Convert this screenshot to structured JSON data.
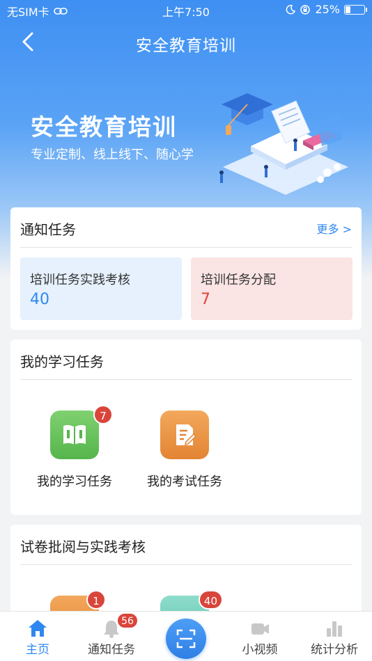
{
  "status_bar": {
    "carrier": "无SIM卡",
    "time": "上午7:50",
    "battery": "25%",
    "battery_level": 0.25
  },
  "nav": {
    "title": "安全教育培训"
  },
  "banner": {
    "title": "安全教育培训",
    "subtitle": "专业定制、线上线下、随心学"
  },
  "notice": {
    "title": "通知任务",
    "more": "更多 >",
    "tasks": [
      {
        "label": "培训任务实践考核",
        "count": "40"
      },
      {
        "label": "培训任务分配",
        "count": "7"
      }
    ]
  },
  "study": {
    "title": "我的学习任务",
    "items": [
      {
        "label": "我的学习任务",
        "badge": "7",
        "icon": "book-icon"
      },
      {
        "label": "我的考试任务",
        "badge": "",
        "icon": "exam-pen-icon"
      }
    ]
  },
  "review": {
    "title": "试卷批阅与实践考核",
    "items": [
      {
        "badge": "1"
      },
      {
        "badge": "40"
      }
    ]
  },
  "tab_bar": {
    "tabs": [
      {
        "label": "主页",
        "icon": "home-icon"
      },
      {
        "label": "通知任务",
        "icon": "bell-icon",
        "badge": "56"
      },
      {
        "label": "",
        "icon": "scan-icon"
      },
      {
        "label": "小视频",
        "icon": "video-camera-icon"
      },
      {
        "label": "统计分析",
        "icon": "bar-chart-icon"
      }
    ]
  },
  "colors": {
    "primary": "#2f88f0",
    "danger": "#e0433a",
    "badge": "#d9453b"
  }
}
